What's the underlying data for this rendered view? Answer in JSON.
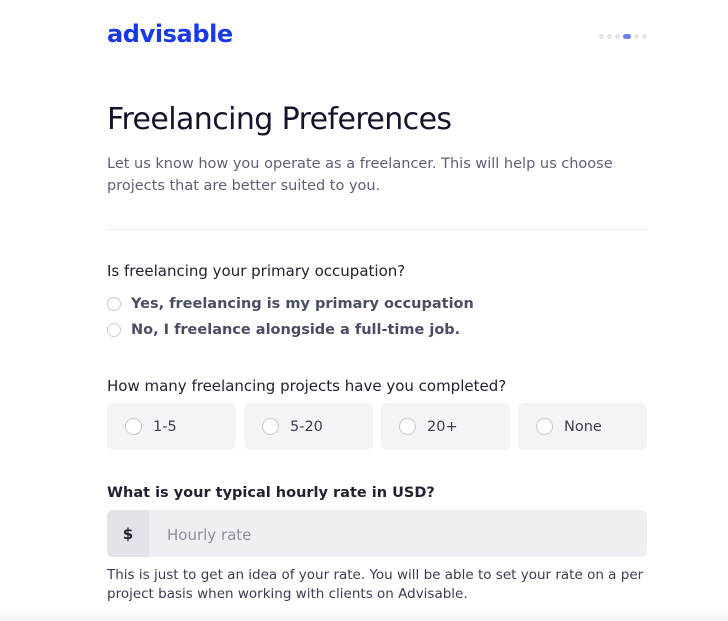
{
  "brand": {
    "logo_text": "advisable",
    "accent_color": "#1739e6"
  },
  "progress": {
    "steps_total": 6,
    "current_step": 4
  },
  "header": {
    "title": "Freelancing Preferences",
    "subtitle": "Let us know how you operate as a freelancer. This will help us choose projects that are better suited to you."
  },
  "questions": {
    "primary": {
      "label": "Is freelancing your primary occupation?",
      "options": [
        "Yes, freelancing is my primary occupation",
        "No, I freelance alongside a full-time job."
      ]
    },
    "projects": {
      "label": "How many freelancing projects have you completed?",
      "options": [
        "1-5",
        "5-20",
        "20+",
        "None"
      ]
    },
    "rate": {
      "label": "What is your typical hourly rate in USD?",
      "prefix": "$",
      "placeholder": "Hourly rate",
      "value": "",
      "help": "This is just to get an idea of your rate. You will be able to set your rate on a per project basis when working with clients on Advisable."
    }
  }
}
